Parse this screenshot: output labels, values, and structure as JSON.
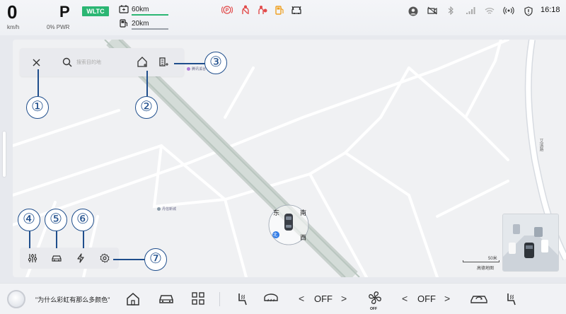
{
  "status": {
    "speed": "0",
    "speed_unit": "km/h",
    "gear": "P",
    "power": "0% PWR",
    "cycle_badge": "WLTC",
    "range_battery": "60km",
    "range_fuel": "20km",
    "time": "16:18",
    "telltale_icons": [
      "parking-brake-icon",
      "seatbelt-icon",
      "airbag-icon",
      "fuel-icon",
      "door-open-icon"
    ],
    "system_icons": [
      "user-avatar-icon",
      "camera-off-icon",
      "bluetooth-icon",
      "signal-icon",
      "wifi-icon",
      "hotspot-icon",
      "shield-icon"
    ],
    "colors": {
      "badge": "#2bb673",
      "battery_bar": "#2bb673",
      "telltale": "#e24b4b",
      "fuel_warn": "#f0a020",
      "callout": "#1f4e8c"
    }
  },
  "map": {
    "search_placeholder": "搜索目的地",
    "poi_near_search": "腾讯溪谷",
    "poi_left": "丹信新城",
    "road_label": "艾溪路",
    "compass": {
      "east": "东",
      "south": "南",
      "west": "西",
      "north": "北"
    },
    "scale": "50米",
    "attribution": "高德地图",
    "search_icons": [
      "close-icon",
      "search-icon",
      "home-icon",
      "company-icon"
    ],
    "tool_icons": [
      "sliders-icon",
      "car-icon",
      "charging-icon",
      "gear-icon"
    ]
  },
  "callouts": [
    "①",
    "②",
    "③",
    "④",
    "⑤",
    "⑥",
    "⑦"
  ],
  "dock": {
    "assistant_text": "\"为什么彩虹有那么多颜色\"",
    "app_icons": [
      "home-icon",
      "car-icon",
      "apps-grid-icon"
    ],
    "seat_heat_left_icon": "seat-heat-icon",
    "defrost_icon": "rear-defrost-icon",
    "temp_left": "OFF",
    "fan_label": "OFF",
    "temp_right": "OFF",
    "prev_symbol": "<",
    "next_symbol": ">",
    "recirc_icon": "car-recirculation-icon",
    "seat_heat_right_icon": "seat-heat-icon"
  }
}
